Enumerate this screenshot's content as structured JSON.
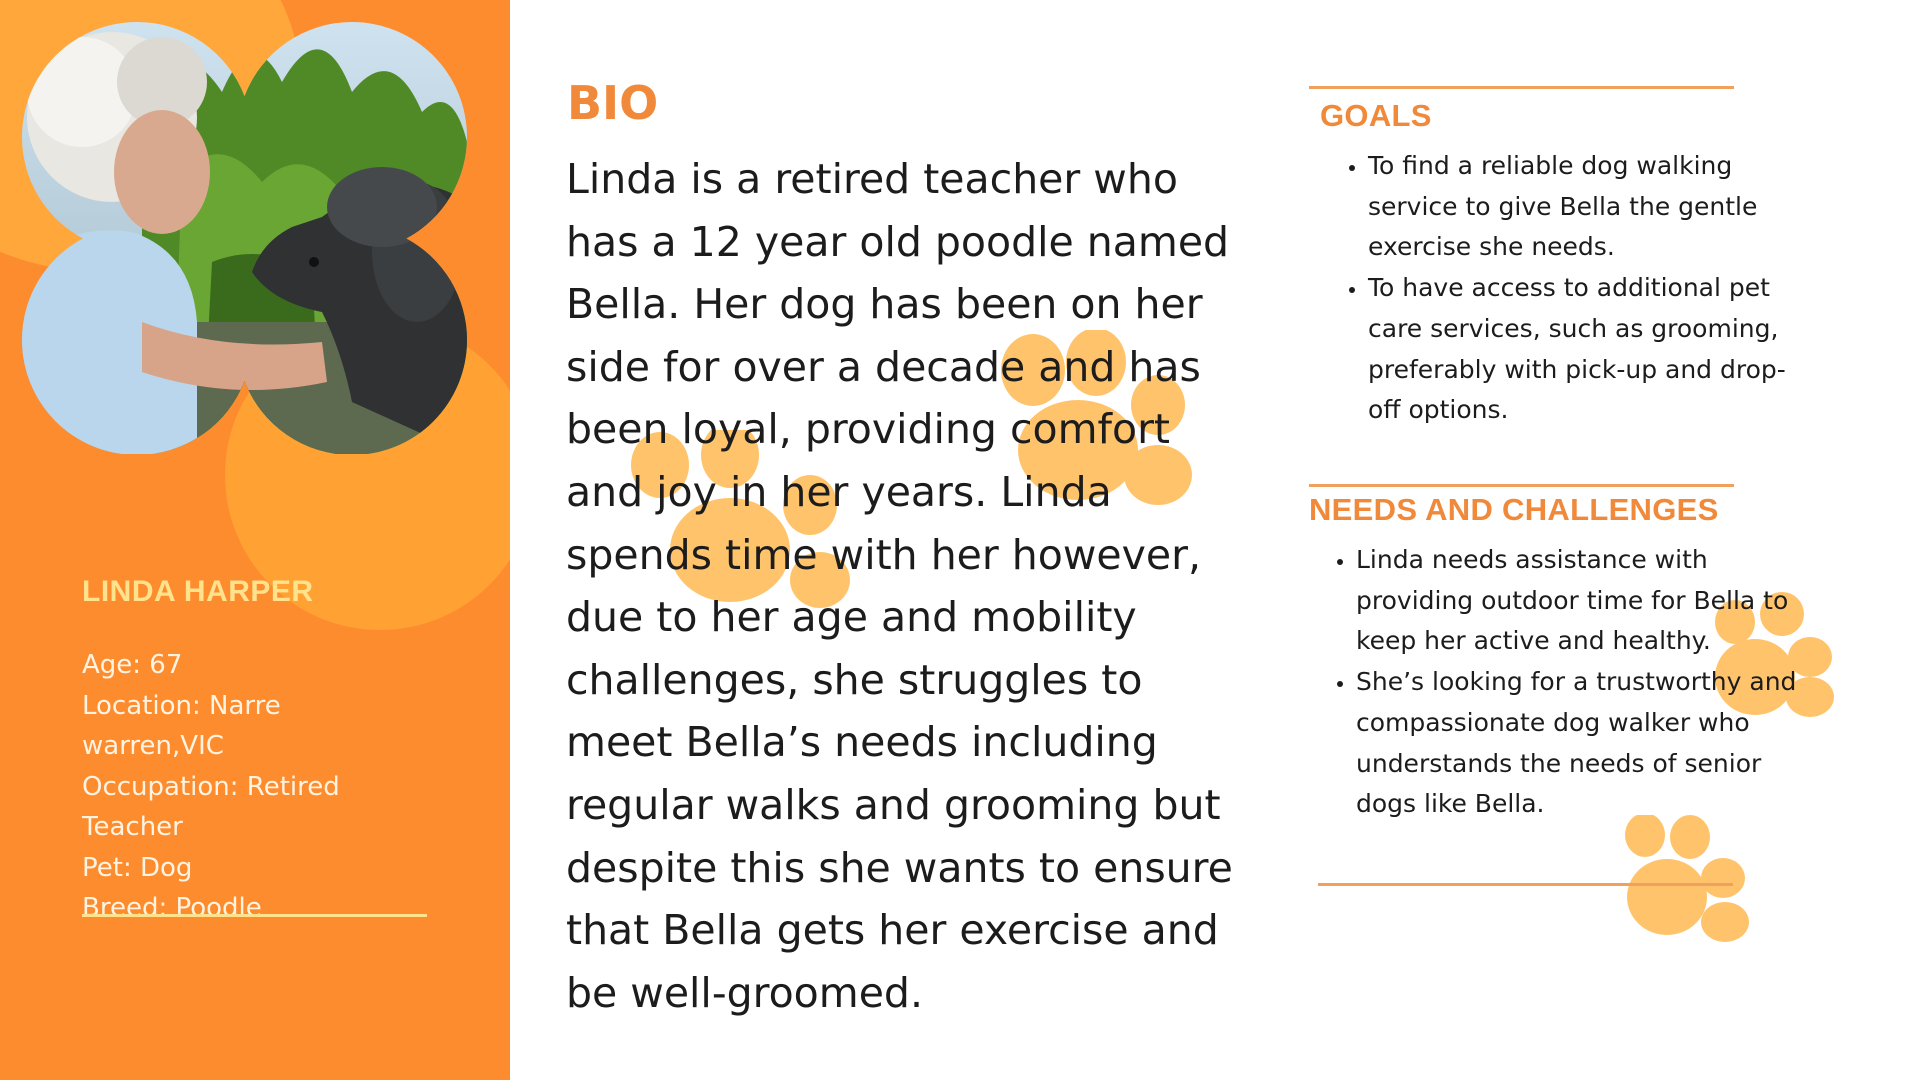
{
  "profile": {
    "name": "LINDA HARPER",
    "details": [
      "Age: 67",
      "Location: Narre warren,VIC",
      "Occupation: Retired Teacher",
      "Pet: Dog",
      "Breed: Poodle"
    ]
  },
  "bio": {
    "title": "BIO",
    "text": "Linda is a retired teacher who has a 12 year old poodle named Bella. Her dog has been on her side for over a decade and has been loyal, providing comfort and joy in her years. Linda spends time with her however, due to her age and mobility challenges, she struggles to meet Bella’s needs including regular walks and grooming but despite this she wants to ensure that Bella gets her exercise and be well-groomed."
  },
  "goals": {
    "title": "GOALS",
    "items": [
      "To find a reliable dog walking service to give Bella the gentle exercise she needs.",
      "To have access to additional pet care services, such as grooming, preferably with pick-up and drop-off options."
    ]
  },
  "needs": {
    "title": "NEEDS AND CHALLENGES",
    "items": [
      "Linda needs assistance with providing outdoor time for Bella to keep her active and healthy.",
      "She’s looking for a trustworthy and compassionate dog walker who understands the needs of senior dogs like Bella."
    ]
  },
  "colors": {
    "panel": "#fd8c2f",
    "accent": "#f0893a",
    "name": "#ffe28c",
    "paw": "#ffc46b"
  },
  "icons": [
    "paw-print-icon"
  ]
}
